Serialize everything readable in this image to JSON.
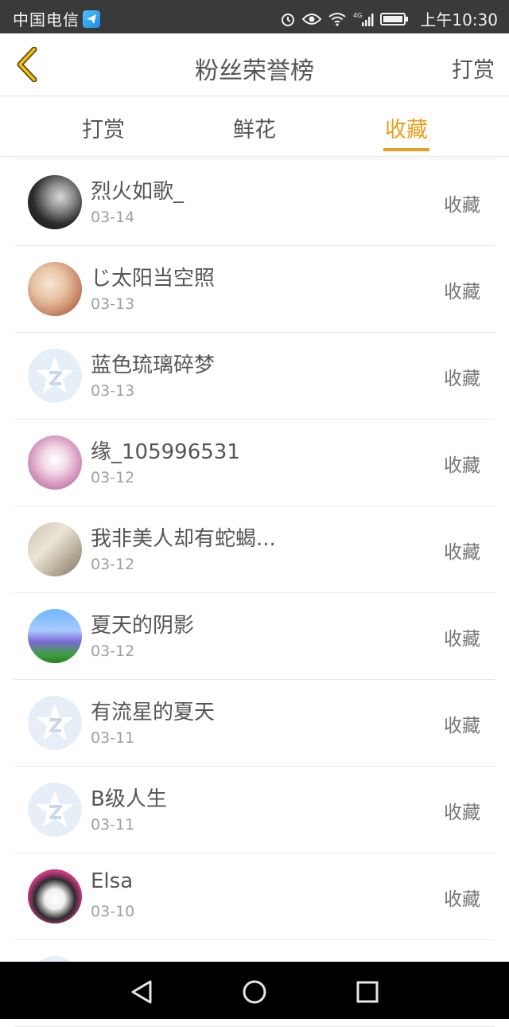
{
  "status_bar": {
    "carrier": "中国电信",
    "network_badge": "4G",
    "time": "上午10:30",
    "icons": [
      "app-notification-icon",
      "alarm-icon",
      "eye-icon",
      "wifi-icon",
      "signal-icon",
      "battery-icon"
    ]
  },
  "header": {
    "back_icon": "chevron-left-icon",
    "title": "粉丝荣誉榜",
    "action": "打赏"
  },
  "tabs": [
    {
      "label": "打赏",
      "active": false
    },
    {
      "label": "鲜花",
      "active": false
    },
    {
      "label": "收藏",
      "active": true
    }
  ],
  "fans": [
    {
      "name": "烈火如歌_",
      "date": "03-14",
      "action": "收藏",
      "avatar": "photo-dark"
    },
    {
      "name": "じ太阳当空照",
      "date": "03-13",
      "action": "收藏",
      "avatar": "photo-warm"
    },
    {
      "name": "蓝色琉璃碎梦",
      "date": "03-13",
      "action": "收藏",
      "avatar": "default-qq-star"
    },
    {
      "name": "缘_105996531",
      "date": "03-12",
      "action": "收藏",
      "avatar": "photo-pink"
    },
    {
      "name": "我非美人却有蛇蝎...",
      "date": "03-12",
      "action": "收藏",
      "avatar": "photo-beige"
    },
    {
      "name": "夏天的阴影",
      "date": "03-12",
      "action": "收藏",
      "avatar": "photo-castle"
    },
    {
      "name": "有流星的夏天",
      "date": "03-11",
      "action": "收藏",
      "avatar": "default-qq-star"
    },
    {
      "name": "B级人生",
      "date": "03-11",
      "action": "收藏",
      "avatar": "default-qq-star"
    },
    {
      "name": "Elsa",
      "date": "03-10",
      "action": "收藏",
      "avatar": "photo-girl"
    },
    {
      "name": "",
      "date": "",
      "action": "",
      "avatar": "default-qq-star"
    }
  ],
  "nav_bar": {
    "icons": [
      "back-triangle-icon",
      "home-circle-icon",
      "recents-square-icon"
    ]
  },
  "colors": {
    "accent": "#e8a020",
    "text": "#555555",
    "muted": "#a0a0a0",
    "status_bar": "#3a3a3a"
  }
}
